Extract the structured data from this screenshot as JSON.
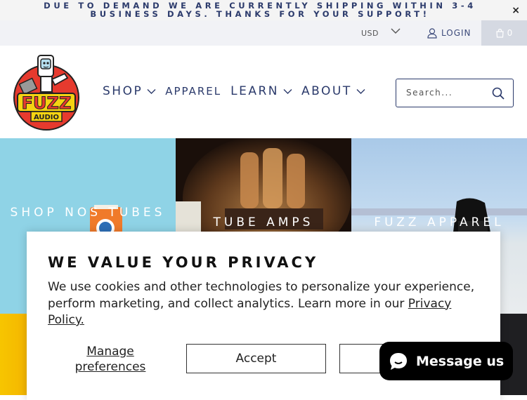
{
  "announcement": {
    "text": "Due to demand we are currently shipping within 3-4 business days. Thanks for your support!",
    "close": "×"
  },
  "utility": {
    "currency": "USD",
    "login": "LOGIN",
    "cart_count": "0"
  },
  "logo": {
    "text_top": "FUZZ",
    "text_bottom": "AUDIO"
  },
  "nav": {
    "shop": "SHOP",
    "apparel": "APPAREL",
    "learn": "LEARN",
    "about": "ABOUT"
  },
  "search": {
    "placeholder": "Search..."
  },
  "tiles": [
    {
      "label": "SHOP NOS TUBES"
    },
    {
      "label": "TUBE AMPS"
    },
    {
      "label": "FUZZ APPAREL"
    }
  ],
  "privacy": {
    "title": "WE VALUE YOUR PRIVACY",
    "body": "We use cookies and other technologies to personalize your experience, perform marketing, and collect analytics. Learn more in our",
    "link": "Privacy Policy.",
    "manage": "Manage preferences",
    "accept": "Accept"
  },
  "chat": {
    "label": "Message us"
  },
  "colors": {
    "navy": "#2b3a6b",
    "logo_red": "#e63a2e",
    "logo_yellow": "#f5d312"
  }
}
